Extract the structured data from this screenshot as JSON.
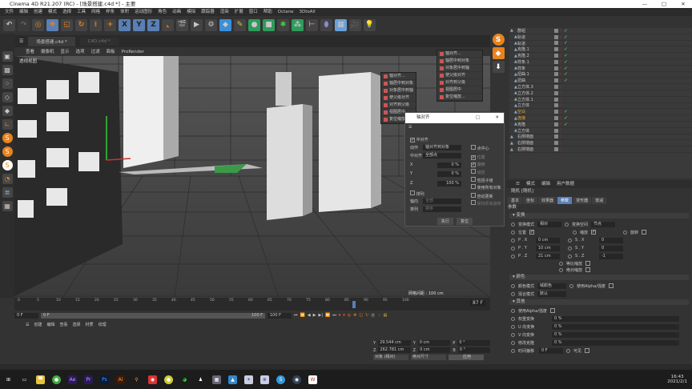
{
  "window": {
    "title": "Cinema 4D R21.207 (RC) - [场景搭建.c4d *] - 主要",
    "min": "—",
    "max": "□",
    "close": "✕"
  },
  "menu": [
    "文件",
    "编辑",
    "创建",
    "模式",
    "选择",
    "工具",
    "网格",
    "样条",
    "体积",
    "运动图形",
    "角色",
    "动画",
    "模拟",
    "跟踪器",
    "渲染",
    "扩展",
    "窗口",
    "帮助",
    "Octane",
    "3DtoAll"
  ],
  "toolbar": {
    "axis_x": "X",
    "axis_y": "Y",
    "axis_z": "Z"
  },
  "tabs": [
    {
      "label": "场景搭建.c4d *"
    },
    {
      "label": "C4D.c4d *"
    }
  ],
  "viewport": {
    "menu": [
      "查看",
      "摄像机",
      "显示",
      "选项",
      "过滤",
      "面板",
      "ProRender"
    ],
    "label": "透视视图",
    "grid_spacing": "网格间距 : 100 cm"
  },
  "align_menu": [
    "轴对齐...",
    "轴居中到对象",
    "对象居中到轴",
    "使父级对齐",
    "对齐到父级",
    "视图居中",
    "复位缩放..."
  ],
  "dialog": {
    "title": "轴对齐",
    "center_align": "中对齐",
    "action_label": "动作",
    "action_value": "轴对齐到对象",
    "mid_label": "中对齐",
    "mid_value": "全部点",
    "x_label": "X",
    "x_val": "0 %",
    "y_label": "Y",
    "y_val": "0 %",
    "z_label": "Z",
    "z_val": "100 %",
    "arrange": "排列",
    "axis_label": "轴向",
    "axis_value": "全部",
    "sort_label": "排列",
    "sort_value": "排序",
    "point_center": "点中心",
    "position": "位置",
    "rotation": "旋转",
    "scale": "缩放",
    "include_children": "包括子级",
    "use_all": "使用所有对象",
    "auto_update": "自动更新",
    "keep": "保持原来旋转",
    "execute": "执行",
    "reset": "复位"
  },
  "objects": [
    "群组",
    "轨道",
    "轨道",
    "克隆.1",
    "克隆.2",
    "样条.1",
    "样条",
    "扭曲.1",
    "扭曲",
    "立方体.3",
    "立方体.2",
    "立方体.1",
    "立方体",
    "空白",
    "连接",
    "克隆",
    "立方体",
    "右侧墙面",
    "右侧墙面",
    "右侧墙面"
  ],
  "attributes": {
    "menu": [
      "模式",
      "编辑",
      "用户数据"
    ],
    "object": "随机 [随机]",
    "tabs": [
      "基本",
      "坐标",
      "效果器",
      "参数",
      "变形器",
      "衰减"
    ],
    "active_tab": "参数",
    "section_params": "参数",
    "sec_transform": "变换",
    "transform_mode": "变换模式",
    "transform_mode_val": "相对",
    "transform_space": "变换空间",
    "transform_space_val": "节点",
    "pos": "位置",
    "scl": "缩放",
    "rot": "旋转",
    "px": "P . X",
    "px_v": "0 cm",
    "py": "P . Y",
    "py_v": "10 cm",
    "pz": "P . Z",
    "pz_v": "21 cm",
    "sx": "S . X",
    "sx_v": "0",
    "sy": "S . Y",
    "sy_v": "0",
    "sz": "S . Z",
    "sz_v": "-1",
    "uniform": "等比缩放",
    "absolute": "绝对缩放",
    "sec_color": "颜色",
    "color_mode": "颜色模式",
    "color_mode_val": "域颜色",
    "use_alpha": "使用Alpha/强度",
    "blend": "混合模式",
    "blend_val": "默认",
    "sec_other": "其他",
    "use_alpha2": "使用Alpha/强度",
    "weight": "权重变换",
    "weight_v": "0 %",
    "u": "U 向变换",
    "u_v": "0 %",
    "v": "V 向变换",
    "v_v": "0 %",
    "mod": "修改克隆",
    "mod_v": "0 %",
    "time": "时间偏移",
    "time_v": "0 F",
    "visible": "可见"
  },
  "timeline": {
    "ticks": [
      "0",
      "5",
      "10",
      "15",
      "20",
      "25",
      "30",
      "35",
      "40",
      "45",
      "50",
      "55",
      "60",
      "65",
      "70",
      "75",
      "80",
      "85",
      "90",
      "95",
      "100"
    ],
    "current": "87",
    "end_field": "87 F",
    "current_fraction": 0.87
  },
  "transport": {
    "start": "0 F",
    "min": "0 F",
    "max": "100 F",
    "end": "100 F"
  },
  "material_menu": [
    "创建",
    "编辑",
    "查看",
    "选择",
    "材质",
    "纹理"
  ],
  "coords": {
    "y_pos": "29.544 cm",
    "z_pos": "262.781 cm",
    "y_size": "0 cm",
    "z_size": "0 cm",
    "p_rot": "0 °",
    "b_rot": "0 °",
    "y": "Y",
    "z": "Z",
    "p": "P",
    "b": "B",
    "mode": "对象 (相对)",
    "size_mode": "绝对尺寸",
    "apply": "应用"
  },
  "taskbar": {
    "time": "16:43",
    "date": "2021/2/1"
  },
  "colors": {
    "accent": "#5a7fb5",
    "orange": "#e8821e",
    "bg": "#333333"
  }
}
